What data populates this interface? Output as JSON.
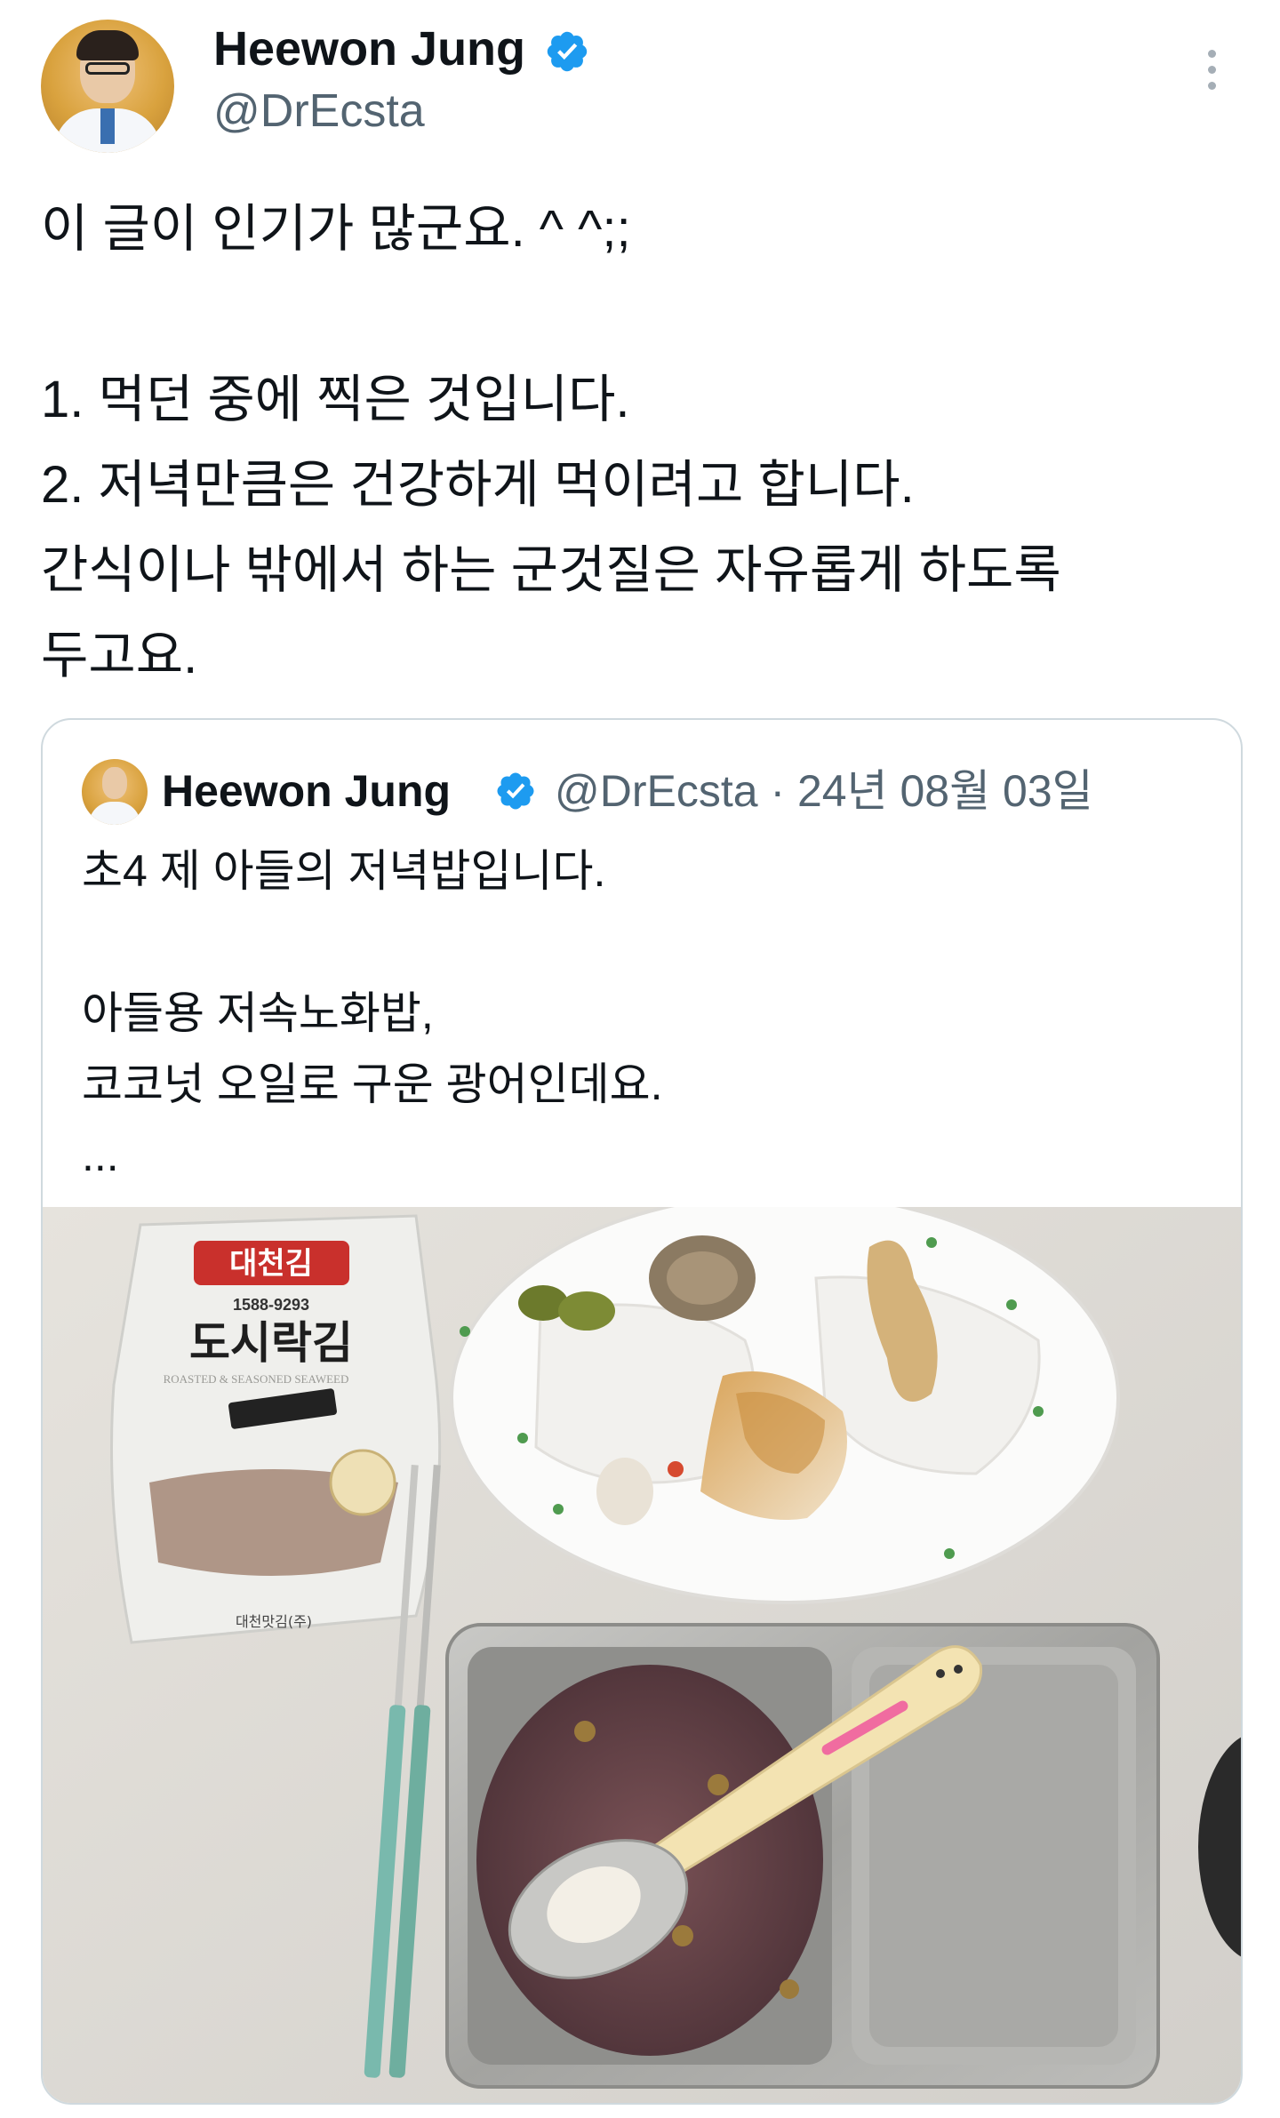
{
  "tweet": {
    "author_name": "Heewon Jung",
    "handle": "@DrEcsta",
    "lines": [
      "이 글이 인기가 많군요. ^ ^;;",
      "",
      "1. 먹던 중에 찍은 것입니다.",
      "2. 저녁만큼은 건강하게 먹이려고 합니다.",
      "간식이나 밖에서 하는 군것질은 자유롭게 하도록",
      "두고요."
    ]
  },
  "quoted_tweet": {
    "author_name": "Heewon Jung",
    "meta": "@DrEcsta · 24년 08월 03일",
    "lines": [
      "초4 제 아들의 저녁밥입니다.",
      "",
      "아들용 저속노화밥,",
      "코코넛 오일로 구운 광어인데요.",
      "..."
    ],
    "photo_labels": {
      "brand": "대천김",
      "phone": "1588-9293",
      "product": "도시락김",
      "subtitle": "ROASTED & SEASONED SEAWEED",
      "maker": "대천맛김(주)"
    }
  },
  "colors": {
    "verified": "#1d9bf0",
    "secondary_text": "#536471",
    "border": "#cfd9de"
  },
  "icons": {
    "verified": "verified-badge-icon",
    "more": "more-options-icon"
  }
}
